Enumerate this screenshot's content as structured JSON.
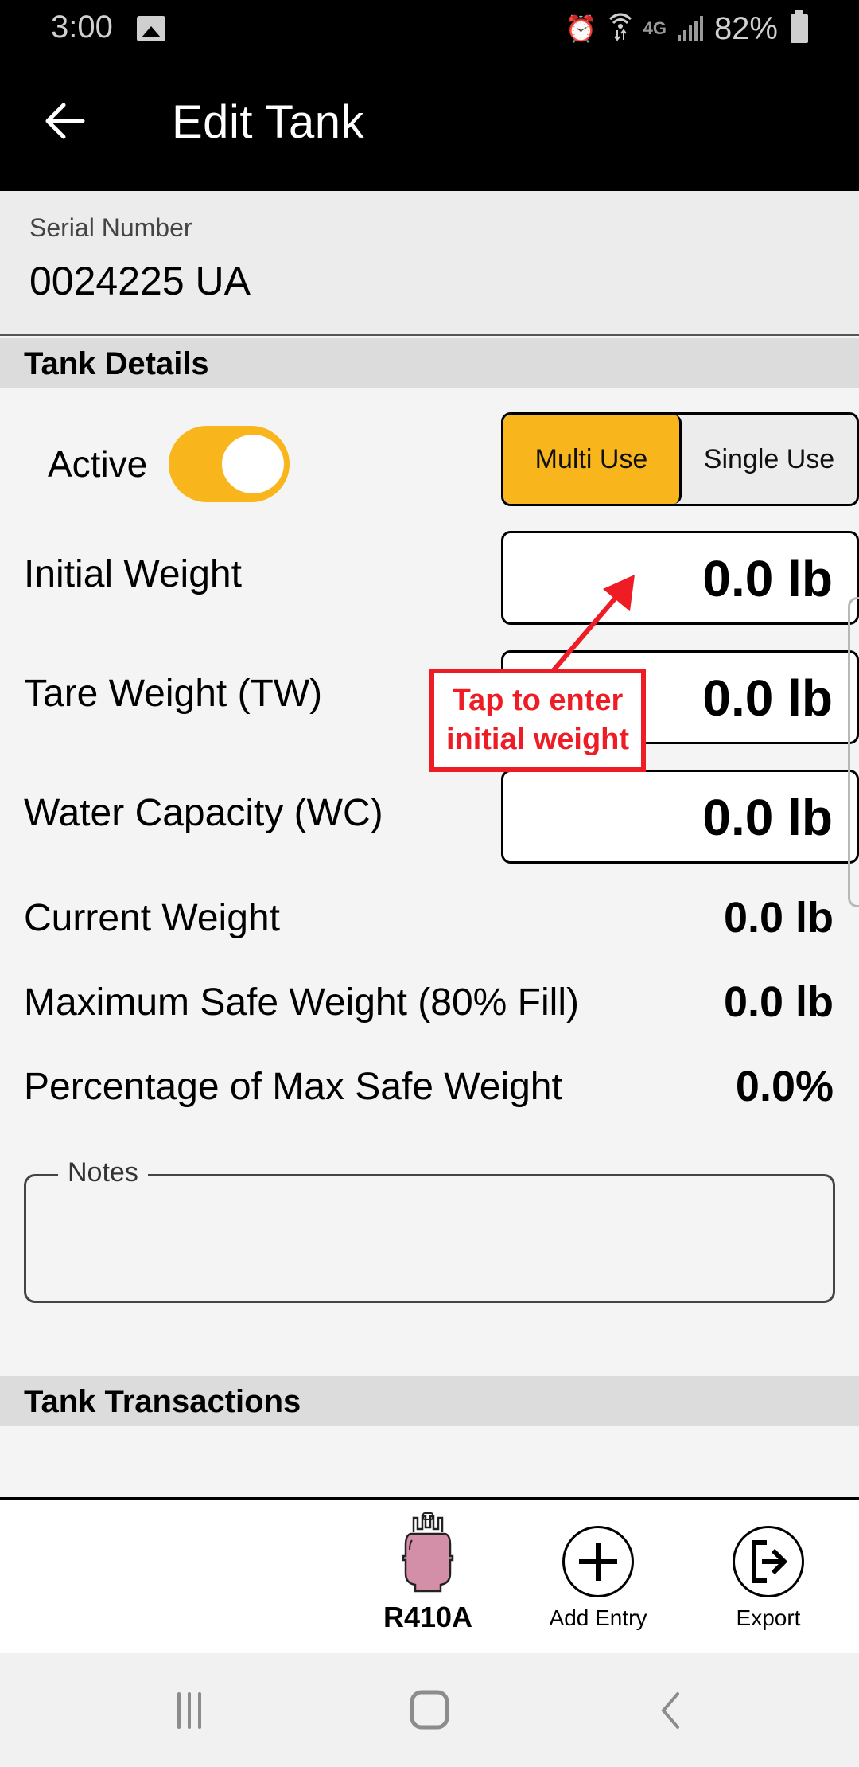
{
  "status_bar": {
    "time": "3:00",
    "battery": "82%",
    "icons": [
      "gallery-icon",
      "alarm-icon",
      "wifi-icon",
      "4g-lte-icon",
      "signal-icon",
      "battery-icon"
    ],
    "network": "4G"
  },
  "app_bar": {
    "title": "Edit Tank",
    "back_icon": "arrow-left-icon"
  },
  "serial": {
    "label": "Serial Number",
    "value": "0024225 UA"
  },
  "tank_details": {
    "header": "Tank Details",
    "active_label": "Active",
    "active_on": true,
    "use_type": {
      "options": [
        "Multi Use",
        "Single Use"
      ],
      "selected": "Multi Use"
    },
    "initial_weight": {
      "label": "Initial Weight",
      "value": "0.0 lb"
    },
    "tare_weight": {
      "label": "Tare Weight (TW)",
      "value": "0.0 lb"
    },
    "water_capacity": {
      "label": "Water Capacity (WC)",
      "value": "0.0 lb"
    },
    "current_weight": {
      "label": "Current Weight",
      "value": "0.0 lb"
    },
    "max_safe_weight": {
      "label": "Maximum Safe Weight (80% Fill)",
      "value": "0.0 lb"
    },
    "percent_max": {
      "label": "Percentage of Max Safe Weight",
      "value": "0.0%"
    },
    "notes": {
      "label": "Notes",
      "value": ""
    }
  },
  "callout": {
    "line1": "Tap to enter",
    "line2": "initial weight",
    "color": "#ee1c25"
  },
  "tank_transactions": {
    "header": "Tank Transactions"
  },
  "bottom_bar": {
    "refrigerant": "R410A",
    "refrigerant_color": "#d48fa8",
    "add_entry": "Add Entry",
    "export": "Export"
  },
  "colors": {
    "accent": "#f8b51c",
    "app_bar": "#000000"
  }
}
